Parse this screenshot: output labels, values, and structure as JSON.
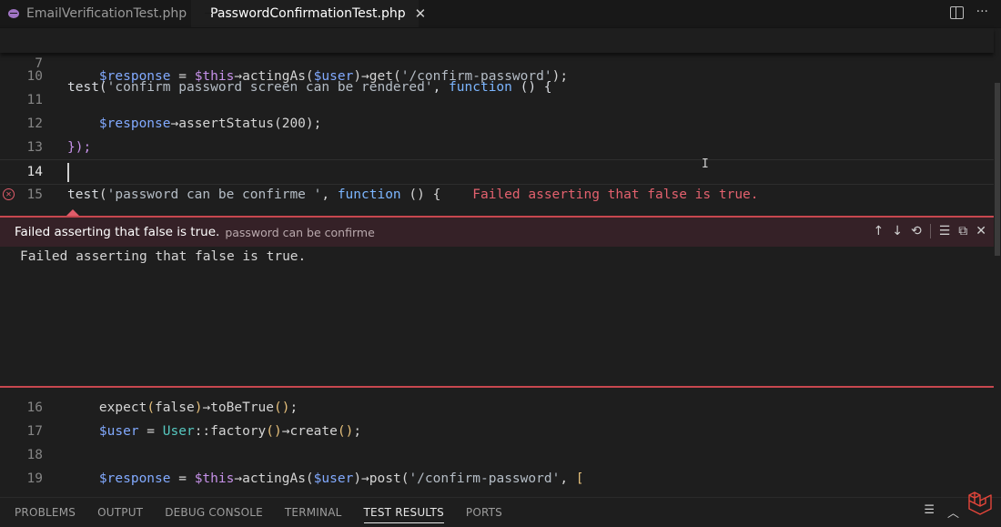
{
  "tabs": [
    {
      "label": "EmailVerificationTest.php",
      "active": false
    },
    {
      "label": "PasswordConfirmationTest.php",
      "active": true,
      "close": "✕"
    }
  ],
  "icons": {
    "split_editor": "split-editor-icon",
    "more": "···",
    "arrow_up": "↑",
    "arrow_down": "↓",
    "history": "⟲",
    "list": "☰",
    "open": "⧉",
    "close": "✕",
    "ibeam": "I",
    "error_circle": "✕",
    "chevron_up": "︿"
  },
  "sticky_line": {
    "number": "7",
    "tokens": [
      {
        "t": "test",
        "c": "k-fn"
      },
      {
        "t": "(",
        "c": "k-fn"
      },
      {
        "t": "'confirm password screen can be rendered'",
        "c": "k-str"
      },
      {
        "t": ", ",
        "c": "k-fn"
      },
      {
        "t": "function",
        "c": "k-kw"
      },
      {
        "t": " () {",
        "c": "k-fn"
      }
    ]
  },
  "code_lines": [
    {
      "number": "10",
      "tokens": [
        {
          "t": "    "
        },
        {
          "t": "$response",
          "c": "k-var"
        },
        {
          "t": " = "
        },
        {
          "t": "$this",
          "c": "k-this"
        },
        {
          "t": "→actingAs("
        },
        {
          "t": "$user",
          "c": "k-var"
        },
        {
          "t": ")→get("
        },
        {
          "t": "'/confirm-password'",
          "c": "k-str"
        },
        {
          "t": ");"
        }
      ]
    },
    {
      "number": "11",
      "tokens": []
    },
    {
      "number": "12",
      "tokens": [
        {
          "t": "    "
        },
        {
          "t": "$response",
          "c": "k-var"
        },
        {
          "t": "→assertStatus("
        },
        {
          "t": "200",
          "c": "k-num"
        },
        {
          "t": ");"
        }
      ]
    },
    {
      "number": "13",
      "tokens": [
        {
          "t": "});",
          "c": "k-this"
        }
      ]
    },
    {
      "number": "14",
      "tokens": [],
      "current": true
    },
    {
      "number": "15",
      "error": true,
      "tokens": [
        {
          "t": "test",
          "c": "k-fn"
        },
        {
          "t": "("
        },
        {
          "t": "'password can be confirme '",
          "c": "k-str"
        },
        {
          "t": ", "
        },
        {
          "t": "function",
          "c": "k-kw"
        },
        {
          "t": " () {"
        },
        {
          "t": "    Failed asserting that false is true.",
          "c": "inline-err"
        }
      ]
    }
  ],
  "peek": {
    "title": "Failed asserting that false is true.",
    "subtitle": "password can be confirme",
    "body": "Failed asserting that false is true.",
    "accent": "#c7474f"
  },
  "code_lines_after": [
    {
      "number": "16",
      "tokens": [
        {
          "t": "    expect"
        },
        {
          "t": "(",
          "c": "k-paren"
        },
        {
          "t": "false"
        },
        {
          "t": ")",
          "c": "k-paren"
        },
        {
          "t": "→toBeTrue"
        },
        {
          "t": "()",
          "c": "k-paren"
        },
        {
          "t": ";"
        }
      ]
    },
    {
      "number": "17",
      "tokens": [
        {
          "t": "    "
        },
        {
          "t": "$user",
          "c": "k-var"
        },
        {
          "t": " = "
        },
        {
          "t": "User",
          "c": "k-class"
        },
        {
          "t": "::factory"
        },
        {
          "t": "()",
          "c": "k-paren"
        },
        {
          "t": "→create"
        },
        {
          "t": "()",
          "c": "k-paren"
        },
        {
          "t": ";"
        }
      ]
    },
    {
      "number": "18",
      "tokens": []
    },
    {
      "number": "19",
      "tokens": [
        {
          "t": "    "
        },
        {
          "t": "$response",
          "c": "k-var"
        },
        {
          "t": " = "
        },
        {
          "t": "$this",
          "c": "k-this"
        },
        {
          "t": "→actingAs("
        },
        {
          "t": "$user",
          "c": "k-var"
        },
        {
          "t": ")→post("
        },
        {
          "t": "'/confirm-password'",
          "c": "k-str"
        },
        {
          "t": ", "
        },
        {
          "t": "[",
          "c": "k-paren"
        }
      ]
    }
  ],
  "panel_tabs": [
    {
      "label": "PROBLEMS"
    },
    {
      "label": "OUTPUT"
    },
    {
      "label": "DEBUG CONSOLE"
    },
    {
      "label": "TERMINAL"
    },
    {
      "label": "TEST RESULTS",
      "active": true
    },
    {
      "label": "PORTS"
    }
  ],
  "colors": {
    "error": "#e05c6a",
    "logo": "#e3453a"
  }
}
